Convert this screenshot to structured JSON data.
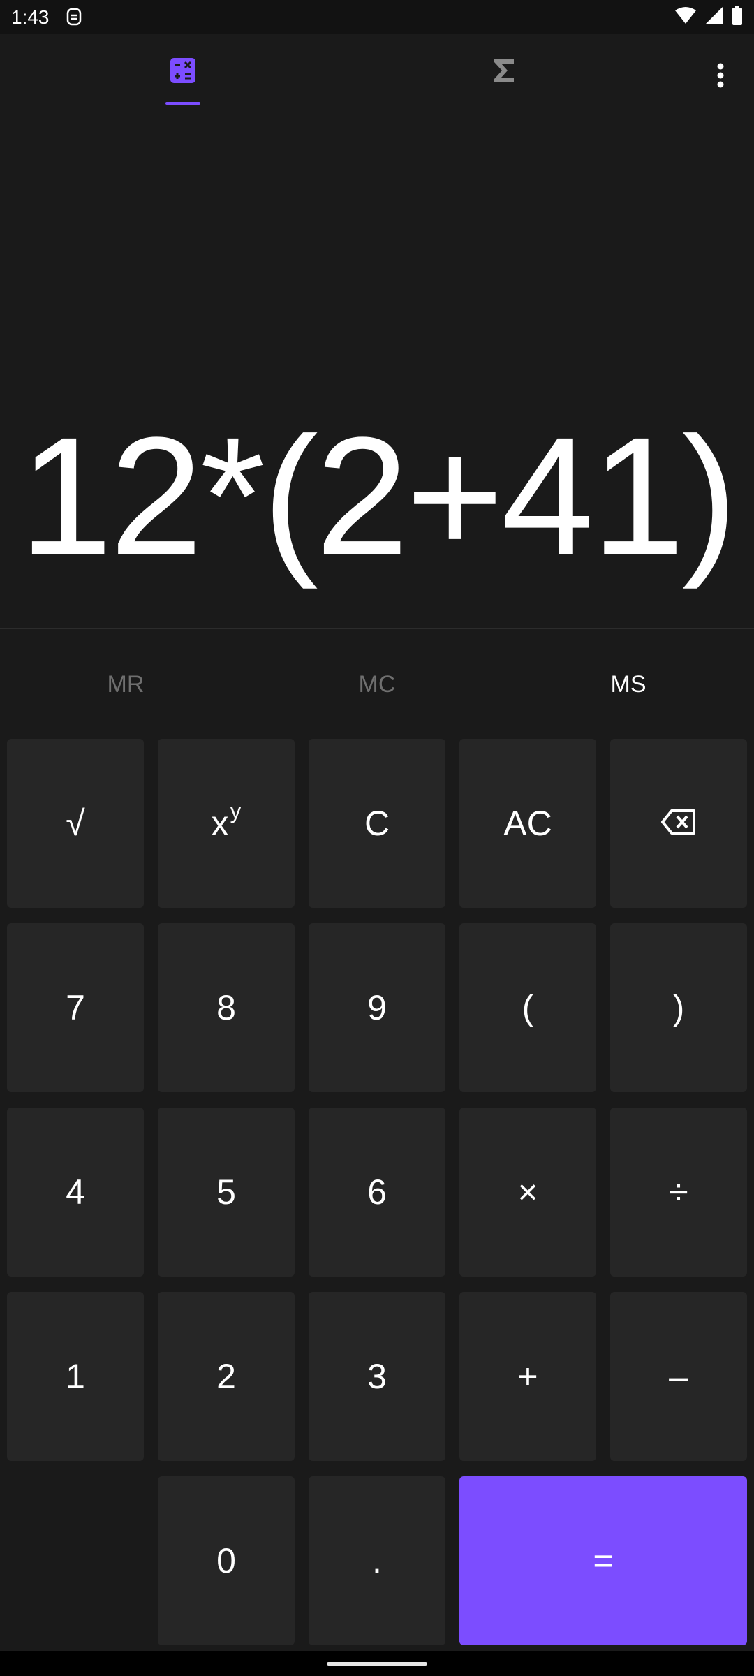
{
  "status_bar": {
    "time": "1:43"
  },
  "icons": {
    "calculator_tab": "calculator-icon",
    "sigma_tab": "sigma-icon",
    "more": "more-vert-icon",
    "backspace": "backspace-icon",
    "wifi": "wifi-icon",
    "signal": "signal-icon",
    "battery": "battery-icon",
    "lens": "screenshot-lens-icon"
  },
  "display": {
    "expression": "12*(2+41)"
  },
  "memory": {
    "mr": "MR",
    "mc": "MC",
    "ms": "MS"
  },
  "keys": {
    "sqrt": "√",
    "power_base": "x",
    "power_exp": "y",
    "clear": "C",
    "all_clear": "AC",
    "seven": "7",
    "eight": "8",
    "nine": "9",
    "lparen": "(",
    "rparen": ")",
    "four": "4",
    "five": "5",
    "six": "6",
    "multiply": "×",
    "divide": "÷",
    "one": "1",
    "two": "2",
    "three": "3",
    "plus": "+",
    "minus": "–",
    "zero": "0",
    "dot": ".",
    "equals": "="
  },
  "colors": {
    "accent": "#7c4dff",
    "background": "#1a1a1a",
    "key": "#262626",
    "inactive_text": "#6f6f6f"
  }
}
